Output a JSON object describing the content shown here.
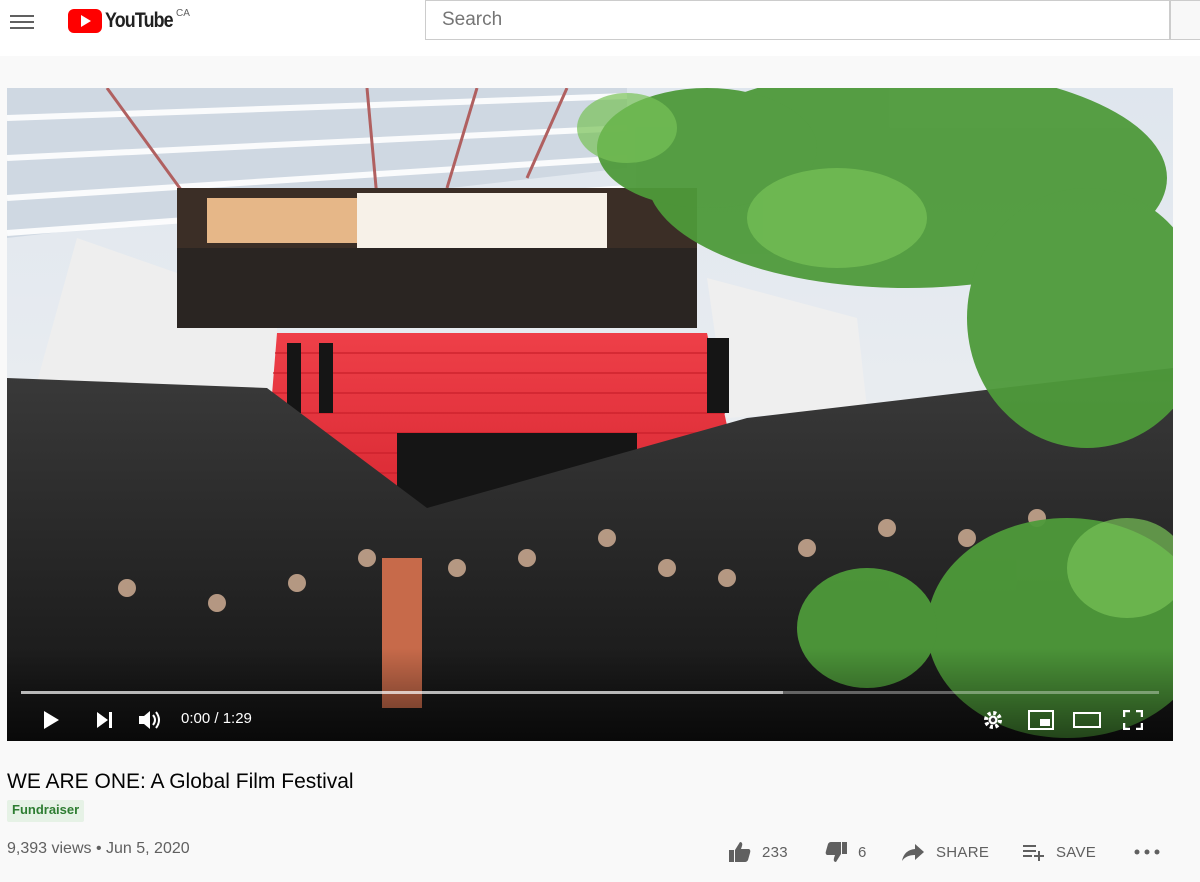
{
  "header": {
    "logo_text": "YouTube",
    "country_code": "CA",
    "search_placeholder": "Search"
  },
  "player": {
    "time_display": "0:00 / 1:29",
    "progress_fraction": 0,
    "buffered_fraction": 0.67
  },
  "video": {
    "title": "WE ARE ONE: A Global Film Festival",
    "badge": "Fundraiser",
    "views": "9,393 views",
    "date": "Jun 5, 2020",
    "meta_separator": "•"
  },
  "actions": {
    "likes": "233",
    "dislikes": "6",
    "share_label": "SHARE",
    "save_label": "SAVE"
  },
  "colors": {
    "brand_red": "#ff0000",
    "carpet_red": "#e8323a",
    "badge_green": "#2e7d32"
  }
}
